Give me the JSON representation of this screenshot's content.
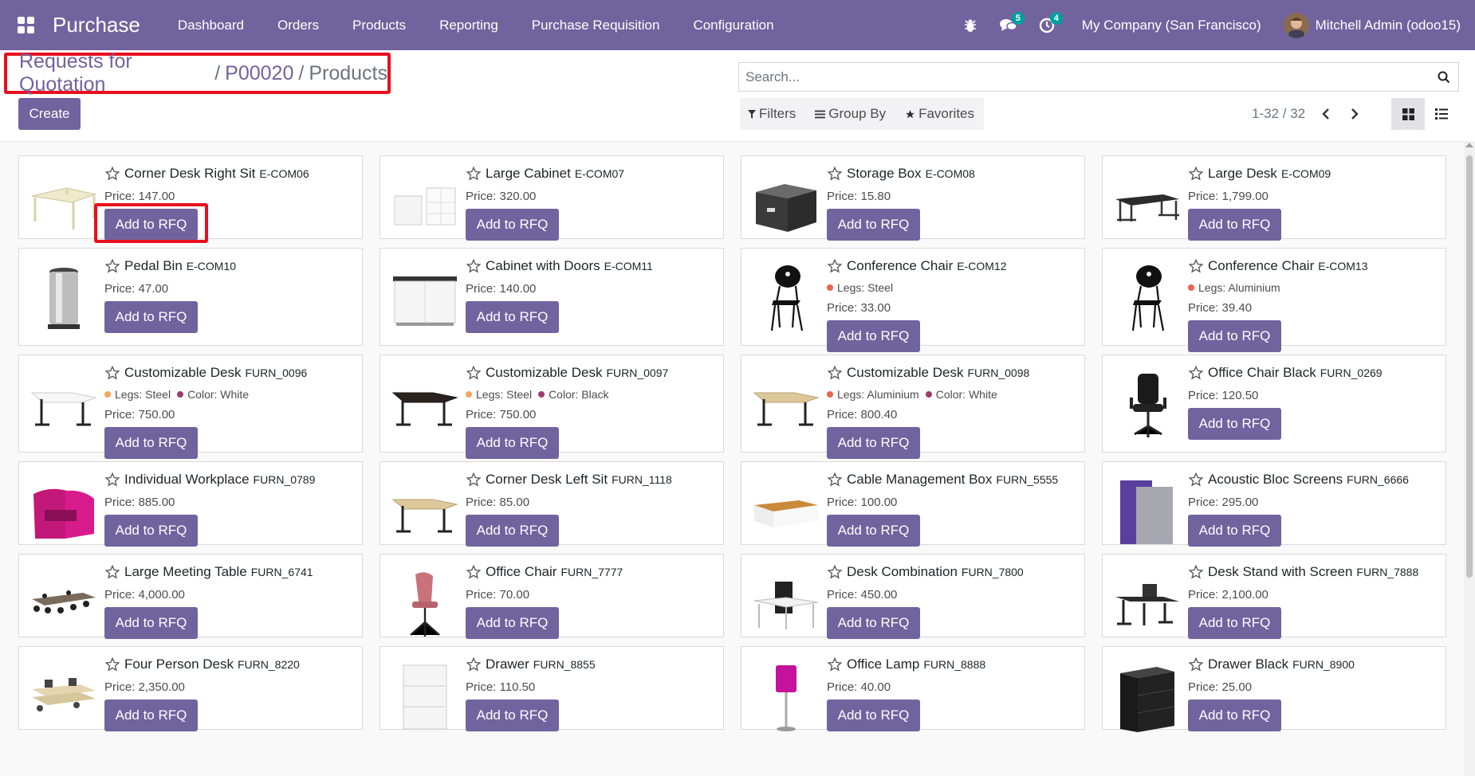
{
  "navbar": {
    "app_name": "Purchase",
    "menu": [
      "Dashboard",
      "Orders",
      "Products",
      "Reporting",
      "Purchase Requisition",
      "Configuration"
    ],
    "messages_count": "5",
    "activities_count": "4",
    "company": "My Company (San Francisco)",
    "user": "Mitchell Admin (odoo15)",
    "color": "#71639e"
  },
  "breadcrumb": {
    "link1": "Requests for Quotation",
    "link2": "P00020",
    "current": "Products",
    "sep": "/"
  },
  "control": {
    "create_label": "Create",
    "search_placeholder": "Search...",
    "filters_label": "Filters",
    "groupby_label": "Group By",
    "favorites_label": "Favorites",
    "pager": "1-32 / 32"
  },
  "button_label": "Add to RFQ",
  "products": [
    {
      "name": "Corner Desk Right Sit",
      "code": "E-COM06",
      "price": "Price: 147.00",
      "attrs": [],
      "icon": "corner-desk-white"
    },
    {
      "name": "Large Cabinet",
      "code": "E-COM07",
      "price": "Price: 320.00",
      "attrs": [],
      "icon": "cabinet-white"
    },
    {
      "name": "Storage Box",
      "code": "E-COM08",
      "price": "Price: 15.80",
      "attrs": [],
      "icon": "storage-box"
    },
    {
      "name": "Large Desk",
      "code": "E-COM09",
      "price": "Price: 1,799.00",
      "attrs": [],
      "icon": "large-desk"
    },
    {
      "name": "Pedal Bin",
      "code": "E-COM10",
      "price": "Price: 47.00",
      "attrs": [],
      "icon": "pedal-bin"
    },
    {
      "name": "Cabinet with Doors",
      "code": "E-COM11",
      "price": "Price: 140.00",
      "attrs": [],
      "icon": "cabinet-doors"
    },
    {
      "name": "Conference Chair",
      "code": "E-COM12",
      "price": "Price: 33.00",
      "attrs": [
        {
          "text": "Legs: Steel",
          "color": "#f06050"
        }
      ],
      "icon": "conference-chair"
    },
    {
      "name": "Conference Chair",
      "code": "E-COM13",
      "price": "Price: 39.40",
      "attrs": [
        {
          "text": "Legs: Aluminium",
          "color": "#f06050"
        }
      ],
      "icon": "conference-chair"
    },
    {
      "name": "Customizable Desk",
      "code": "FURN_0096",
      "price": "Price: 750.00",
      "attrs": [
        {
          "text": "Legs: Steel",
          "color": "#f4a460"
        },
        {
          "text": "Color: White",
          "color": "#9c3b6d"
        }
      ],
      "icon": "desk-white"
    },
    {
      "name": "Customizable Desk",
      "code": "FURN_0097",
      "price": "Price: 750.00",
      "attrs": [
        {
          "text": "Legs: Steel",
          "color": "#f4a460"
        },
        {
          "text": "Color: Black",
          "color": "#9c3b6d"
        }
      ],
      "icon": "desk-black"
    },
    {
      "name": "Customizable Desk",
      "code": "FURN_0098",
      "price": "Price: 800.40",
      "attrs": [
        {
          "text": "Legs: Aluminium",
          "color": "#f06050"
        },
        {
          "text": "Color: White",
          "color": "#9c3b6d"
        }
      ],
      "icon": "desk-wood"
    },
    {
      "name": "Office Chair Black",
      "code": "FURN_0269",
      "price": "Price: 120.50",
      "attrs": [],
      "icon": "office-chair-black"
    },
    {
      "name": "Individual Workplace",
      "code": "FURN_0789",
      "price": "Price: 885.00",
      "attrs": [],
      "icon": "workplace-pink"
    },
    {
      "name": "Corner Desk Left Sit",
      "code": "FURN_1118",
      "price": "Price: 85.00",
      "attrs": [],
      "icon": "desk-wood"
    },
    {
      "name": "Cable Management Box",
      "code": "FURN_5555",
      "price": "Price: 100.00",
      "attrs": [],
      "icon": "cable-box"
    },
    {
      "name": "Acoustic Bloc Screens",
      "code": "FURN_6666",
      "price": "Price: 295.00",
      "attrs": [],
      "icon": "acoustic-screens"
    },
    {
      "name": "Large Meeting Table",
      "code": "FURN_6741",
      "price": "Price: 4,000.00",
      "attrs": [],
      "icon": "meeting-table"
    },
    {
      "name": "Office Chair",
      "code": "FURN_7777",
      "price": "Price: 70.00",
      "attrs": [],
      "icon": "office-chair-pink"
    },
    {
      "name": "Desk Combination",
      "code": "FURN_7800",
      "price": "Price: 450.00",
      "attrs": [],
      "icon": "desk-combination"
    },
    {
      "name": "Desk Stand with Screen",
      "code": "FURN_7888",
      "price": "Price: 2,100.00",
      "attrs": [],
      "icon": "desk-stand-screen"
    },
    {
      "name": "Four Person Desk",
      "code": "FURN_8220",
      "price": "Price: 2,350.00",
      "attrs": [],
      "icon": "four-person-desk"
    },
    {
      "name": "Drawer",
      "code": "FURN_8855",
      "price": "Price: 110.50",
      "attrs": [],
      "icon": "drawer-white"
    },
    {
      "name": "Office Lamp",
      "code": "FURN_8888",
      "price": "Price: 40.00",
      "attrs": [],
      "icon": "office-lamp"
    },
    {
      "name": "Drawer Black",
      "code": "FURN_8900",
      "price": "Price: 25.00",
      "attrs": [],
      "icon": "drawer-black"
    }
  ]
}
